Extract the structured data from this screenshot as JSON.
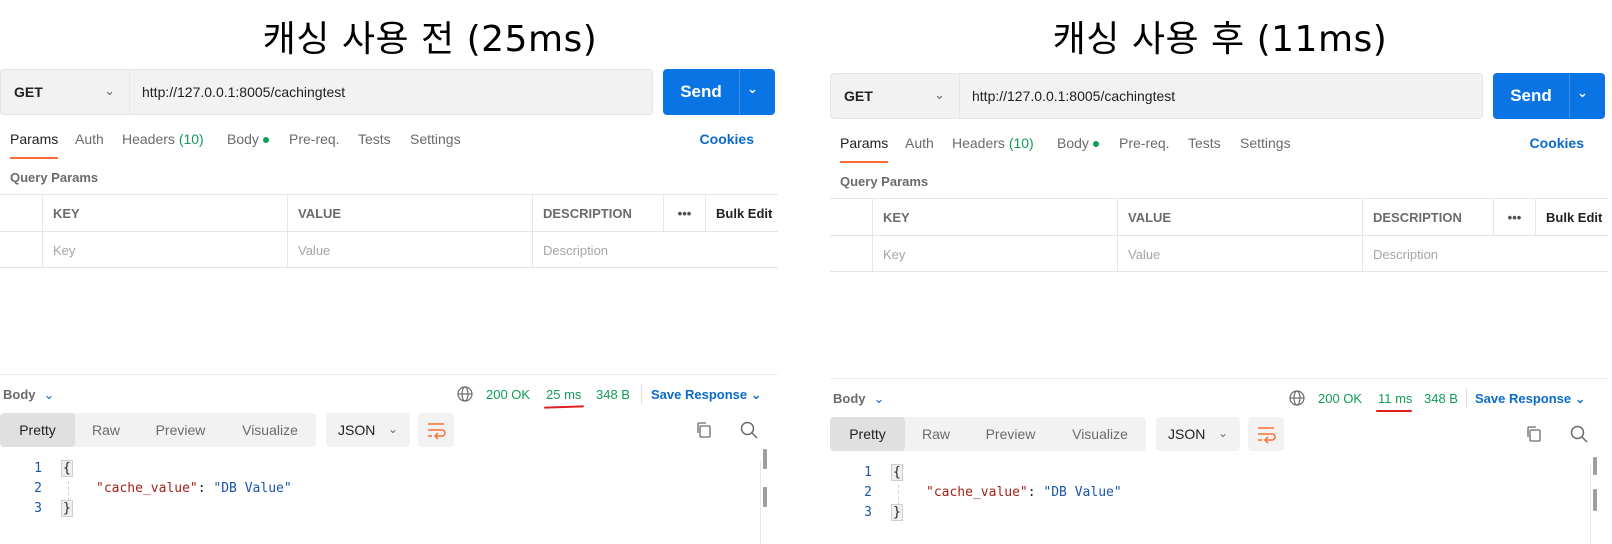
{
  "panels": [
    {
      "caption": "캐싱 사용 전 (25ms)",
      "request": {
        "method": "GET",
        "url": "http://127.0.0.1:8005/cachingtest",
        "send_label": "Send"
      },
      "tabs": {
        "params": "Params",
        "auth": "Auth",
        "headers": "Headers",
        "headers_count": "(10)",
        "body": "Body",
        "prereq": "Pre-req.",
        "tests": "Tests",
        "settings": "Settings",
        "cookies": "Cookies"
      },
      "query_params": {
        "title": "Query Params",
        "columns": {
          "key": "KEY",
          "value": "VALUE",
          "description": "DESCRIPTION",
          "more": "•••",
          "bulk_edit": "Bulk Edit"
        },
        "placeholders": {
          "key": "Key",
          "value": "Value",
          "description": "Description"
        }
      },
      "response": {
        "label": "Body",
        "status": "200 OK",
        "time": "25 ms",
        "size": "348 B",
        "save_label": "Save Response",
        "views": {
          "pretty": "Pretty",
          "raw": "Raw",
          "preview": "Preview",
          "visualize": "Visualize"
        },
        "format": "JSON",
        "lines": [
          "1",
          "2",
          "3"
        ],
        "open_brace": "{",
        "close_brace": "}",
        "json_key": "\"cache_value\"",
        "json_sep": ": ",
        "json_value": "\"DB Value\""
      }
    },
    {
      "caption": "캐싱 사용 후 (11ms)",
      "request": {
        "method": "GET",
        "url": "http://127.0.0.1:8005/cachingtest",
        "send_label": "Send"
      },
      "tabs": {
        "params": "Params",
        "auth": "Auth",
        "headers": "Headers",
        "headers_count": "(10)",
        "body": "Body",
        "prereq": "Pre-req.",
        "tests": "Tests",
        "settings": "Settings",
        "cookies": "Cookies"
      },
      "query_params": {
        "title": "Query Params",
        "columns": {
          "key": "KEY",
          "value": "VALUE",
          "description": "DESCRIPTION",
          "more": "•••",
          "bulk_edit": "Bulk Edit"
        },
        "placeholders": {
          "key": "Key",
          "value": "Value",
          "description": "Description"
        }
      },
      "response": {
        "label": "Body",
        "status": "200 OK",
        "time": "11 ms",
        "size": "348 B",
        "save_label": "Save Response",
        "views": {
          "pretty": "Pretty",
          "raw": "Raw",
          "preview": "Preview",
          "visualize": "Visualize"
        },
        "format": "JSON",
        "lines": [
          "1",
          "2",
          "3"
        ],
        "open_brace": "{",
        "close_brace": "}",
        "json_key": "\"cache_value\"",
        "json_sep": ": ",
        "json_value": "\"DB Value\""
      }
    }
  ],
  "colors": {
    "accent": "#0b74e5",
    "tab_underline": "#ff6c37",
    "success": "#0f9d58",
    "annotation": "#e02020"
  },
  "icons": [
    "chevron-down-icon",
    "globe-icon",
    "wrap-lines-icon",
    "copy-icon",
    "search-icon"
  ]
}
